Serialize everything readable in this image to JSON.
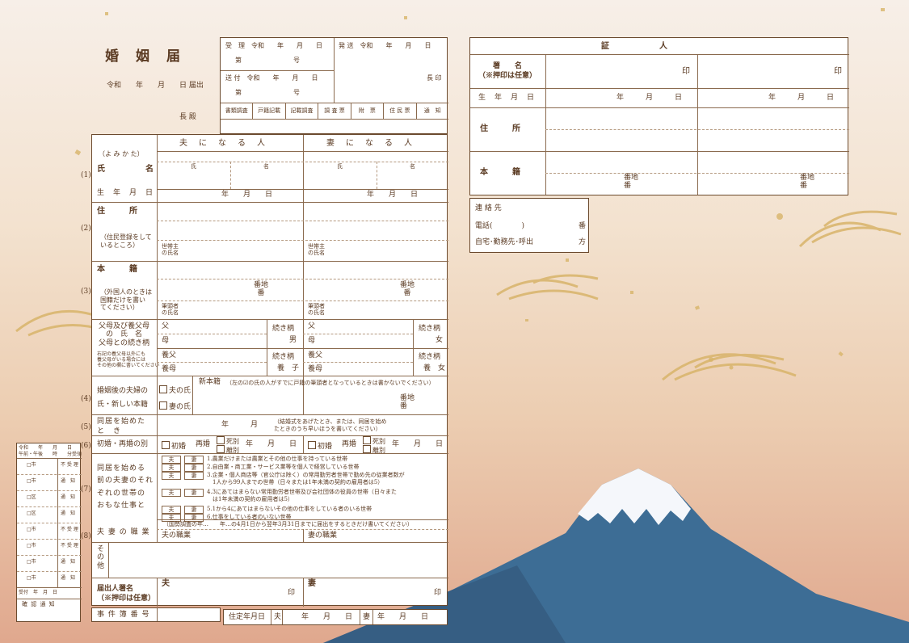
{
  "form": {
    "title": "婚　姻　届",
    "date_line": "令和　　年　　月　　日 届出",
    "chou_den": "長 殿",
    "official": {
      "juri": "受　理　令和　　年　　月　　日",
      "hassou": "発 送　令和　　年　　月　　日",
      "dai1": "第　　　　　　　　号",
      "souhu": "送 付　令和　　年　　月　　日",
      "dai2": "第　　　　　　　　号",
      "chouin": "長 印",
      "checks": [
        "書類調査",
        "戸籍記載",
        "記載調査",
        "調 査 票",
        "附　票",
        "住 民 票",
        "通　知"
      ]
    },
    "columns": {
      "husband": "夫　に　な　る　人",
      "wife": "妻　に　な　る　人"
    },
    "yomikata": "（よ み か た）",
    "shi": "氏",
    "mei": "名",
    "shimei": "氏　　　名",
    "seinengappi": "生　年　月　日",
    "date_ymd": "年　　月　　日",
    "jusho": "住　　　所",
    "jusho_note": "（住民登録をして\nいるところ）",
    "setainushi": "世帯主\nの氏名",
    "honseki": "本　　　籍",
    "honseki_note": "（外国人のときは\n国籍だけを書い\nてください）",
    "banchi": "番地\n番",
    "hittousha": "筆頭者\nの氏名",
    "parents_label": "父母及び養父母\nの　氏　名\n父母との続き柄",
    "parents_note": "右記の養父母以外にも\n養父母がいる場合には\nその他の欄に書いてください",
    "chichi": "父",
    "haha": "母",
    "youfu": "養父",
    "youbo": "養母",
    "zokugara": "続き柄",
    "otoko": "男",
    "onna": "女",
    "youshi": "養　子",
    "youjo": "養　女",
    "row4_label": "婚姻後の夫婦の\n氏・新しい本籍",
    "otto_no_uji": "夫の氏",
    "tsuma_no_uji": "妻の氏",
    "shinhonseki": "新本籍",
    "shinhonseki_note": "（左の☑の氏の人がすでに戸籍の筆頭者となっているときは書かないでください）",
    "row5_label": "同居を始めた\nと　き",
    "nengetsu": "年　　　月",
    "row5_note": "（結婚式をあげたとき、または、同居を始め\nたときのうち早いほうを書いてください）",
    "row6_label": "初婚・再婚の別",
    "shokon": "初婚",
    "saikon": "再婚",
    "shibetsu": "死別",
    "rikon": "離別",
    "row7_label": "同居を始める\n前の夫妻のそれ\nぞれの世帯の\nおもな仕事と",
    "otto": "夫",
    "tsuma": "妻",
    "jobs": [
      "1.農業だけまたは農業とその他の仕事を持っている世帯",
      "2.自由業・商工業・サービス業等を個人で経営している世帯",
      "3.企業・個人商店等（官公庁は除く）の常用勤労者世帯で勤め先の従業者数が\n　1人から99人までの世帯（日々または1年未満の契約の雇用者は5）",
      "4.3にあてはまらない常用勤労者世帯及び会社団体の役員の世帯（日々また\n　は1年未満の契約の雇用者は5）",
      "5.1から4にあてはまらないその他の仕事をしている者のいる世帯",
      "6.仕事をしている者のいない世帯"
    ],
    "row8_label": "夫 妻 の 職 業",
    "kokusei_note": "（国勢調査の年…　　年…の4月1日から翌年3月31日までに届出をするときだけ書いてください）",
    "otto_shokugyo": "夫の職業",
    "tsuma_shokugyo": "妻の職業",
    "sonota": "そ\nの\n他",
    "todokede_label": "届出人署名\n（※押印は任意）",
    "in": "印",
    "jiken": "事 件 簿 番 号",
    "juutei": "住定年月日",
    "juutei_otto": "夫",
    "juutei_tsuma": "妻",
    "ymd_short": "年　　月　　日",
    "row_numbers": [
      "(1)",
      "(2)",
      "(3)",
      "(4)",
      "(5)",
      "(6)",
      "(7)",
      "(8)"
    ]
  },
  "witness": {
    "title": "証　　　　　人",
    "shomei": "署　　名\n（※押印は任意）",
    "in": "印",
    "seinengappi": "生　年　月　日",
    "ymd": "年　　　月　　　日",
    "jusho": "住　　　所",
    "honseki": "本　　　籍",
    "banchi": "番地\n番"
  },
  "contact": {
    "renrakusaki": "連 絡 先",
    "denwa": "電話(　　　　)",
    "ban": "番",
    "jitaku": "自宅･勤務先･呼出",
    "kata": "方"
  },
  "side_slip": {
    "top": "令和　　年　　月　　日\n午前・午後　　時　　分受領",
    "labels": [
      "□市",
      "□市",
      "□区",
      "□区",
      "□市",
      "□市",
      "□市",
      "□市",
      "□市",
      "□市"
    ],
    "side": [
      "不 受 理",
      "通　知",
      "通　知",
      "通　知",
      "不 受 理",
      "不 受 理",
      "通　知",
      "通　知"
    ],
    "bottom": "受付",
    "kakunin": "確 認 通 知",
    "ymd": "年　月　日"
  },
  "colors": {
    "brown": "#5a3a22",
    "mountain": "#3d6d95",
    "snow": "#f5f7fb",
    "gold": "#d8b46a",
    "bg_bottom": "#e0a88e"
  }
}
